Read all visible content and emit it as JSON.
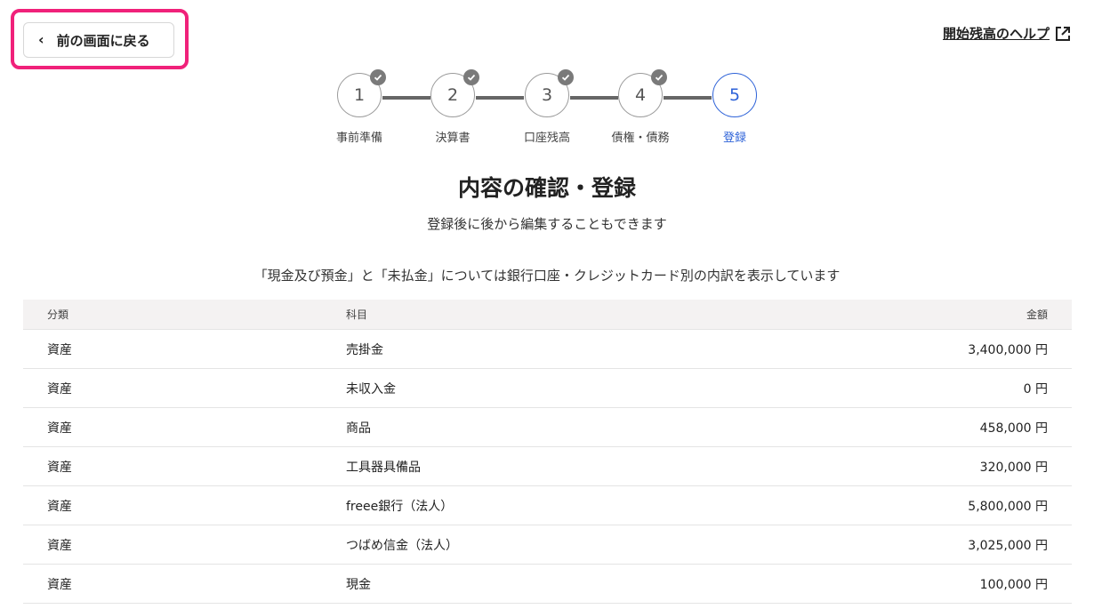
{
  "back_button": {
    "label": "前の画面に戻る"
  },
  "help_link": {
    "label": "開始残高のヘルプ"
  },
  "stepper": {
    "steps": [
      {
        "number": "1",
        "label": "事前準備",
        "completed": true
      },
      {
        "number": "2",
        "label": "決算書",
        "completed": true
      },
      {
        "number": "3",
        "label": "口座残高",
        "completed": true
      },
      {
        "number": "4",
        "label": "債権・債務",
        "completed": true
      },
      {
        "number": "5",
        "label": "登録",
        "completed": false
      }
    ],
    "active_index": 4
  },
  "heading": {
    "title": "内容の確認・登録",
    "subtitle": "登録後に後から編集することもできます"
  },
  "note": "「現金及び預金」と「未払金」については銀行口座・クレジットカード別の内訳を表示しています",
  "table": {
    "headers": [
      "分類",
      "科目",
      "金額"
    ],
    "rows": [
      [
        "資産",
        "売掛金",
        "3,400,000 円"
      ],
      [
        "資産",
        "未収入金",
        "0 円"
      ],
      [
        "資産",
        "商品",
        "458,000 円"
      ],
      [
        "資産",
        "工具器具備品",
        "320,000 円"
      ],
      [
        "資産",
        "freee銀行（法人）",
        "5,800,000 円"
      ],
      [
        "資産",
        "つばめ信金（法人）",
        "3,025,000 円"
      ],
      [
        "資産",
        "現金",
        "100,000 円"
      ]
    ]
  },
  "colors": {
    "highlight": "#f0217a",
    "active": "#2d62d8",
    "check_badge": "#7a7a7a"
  }
}
